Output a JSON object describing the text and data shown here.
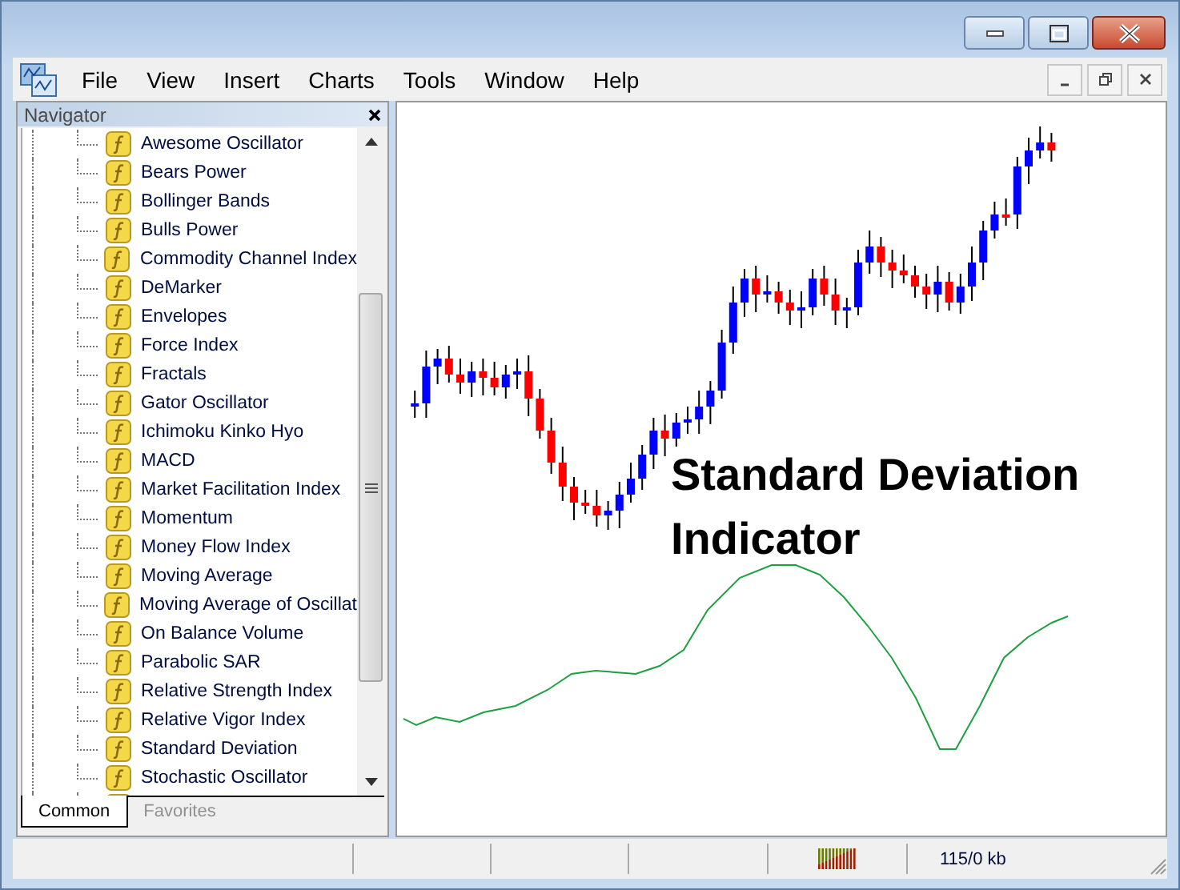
{
  "window": {
    "controls": [
      {
        "kind": "minimize"
      },
      {
        "kind": "maximize"
      },
      {
        "kind": "close"
      }
    ]
  },
  "menu": [
    "File",
    "View",
    "Insert",
    "Charts",
    "Tools",
    "Window",
    "Help"
  ],
  "child_controls": [
    {
      "kind": "minimize"
    },
    {
      "kind": "restore"
    },
    {
      "kind": "close"
    }
  ],
  "navigator": {
    "title": "Navigator",
    "items": [
      "Awesome Oscillator",
      "Bears Power",
      "Bollinger Bands",
      "Bulls Power",
      "Commodity Channel Index",
      "DeMarker",
      "Envelopes",
      "Force Index",
      "Fractals",
      "Gator Oscillator",
      "Ichimoku Kinko Hyo",
      "MACD",
      "Market Facilitation Index",
      "Momentum",
      "Money Flow Index",
      "Moving Average",
      "Moving Average of Oscillat",
      "On Balance Volume",
      "Parabolic SAR",
      "Relative Strength Index",
      "Relative Vigor Index",
      "Standard Deviation",
      "Stochastic Oscillator"
    ],
    "tabs": [
      {
        "label": "Common",
        "selected": true
      },
      {
        "label": "Favorites",
        "selected": false
      }
    ]
  },
  "chart": {
    "caption": "Standard Deviation Indicator"
  },
  "status_bar": {
    "traffic": "115/0 kb"
  }
}
